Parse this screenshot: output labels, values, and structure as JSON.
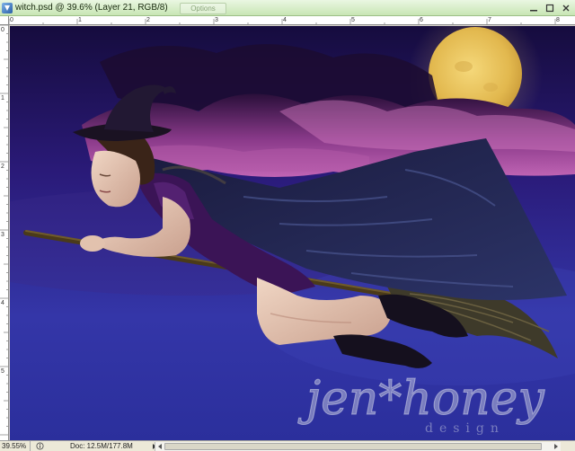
{
  "window": {
    "title": "witch.psd @ 39.6% (Layer 21, RGB/8)",
    "ghost_button": "Options"
  },
  "rulers": {
    "top_ticks": [
      "0",
      "1",
      "2",
      "3",
      "4",
      "5",
      "6",
      "7",
      "8"
    ],
    "left_ticks": [
      "0",
      "1",
      "2",
      "3",
      "4",
      "5"
    ]
  },
  "status": {
    "zoom": "39.55%",
    "doc": "Doc: 12.5M/177.8M"
  },
  "artwork": {
    "watermark_main": "jen*honey",
    "watermark_sub": "design"
  },
  "colors": {
    "titlebar": "#c8e6b4",
    "sky_top": "#1a1050",
    "sky_bottom": "#3a3fb0",
    "moon": "#e8c35a",
    "cloud": "#a04a9a"
  }
}
